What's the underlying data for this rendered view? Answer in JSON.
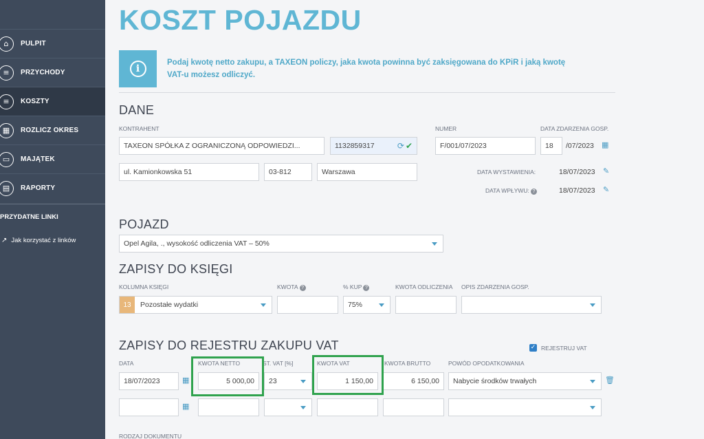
{
  "sidebar": {
    "items": [
      {
        "label": "PULPIT",
        "icon": "home-icon",
        "glyph": "⌂"
      },
      {
        "label": "PRZYCHODY",
        "icon": "coins-plus-icon",
        "glyph": "≡"
      },
      {
        "label": "KOSZTY",
        "icon": "coins-icon",
        "glyph": "≡"
      },
      {
        "label": "ROZLICZ OKRES",
        "icon": "calculator-icon",
        "glyph": "▦"
      },
      {
        "label": "MAJĄTEK",
        "icon": "laptop-icon",
        "glyph": "▭"
      },
      {
        "label": "RAPORTY",
        "icon": "reports-icon",
        "glyph": "▤"
      }
    ],
    "useful_links_heading": "PRZYDATNE LINKI",
    "link_label": "Jak korzystać z linków"
  },
  "page": {
    "title": "KOSZT POJAZDU",
    "info": "Podaj kwotę netto zakupu, a TAXEON policzy, jaka kwota powinna być zaksięgowana do KPiR i jaką kwotę VAT-u możesz odliczyć."
  },
  "dane": {
    "heading": "DANE",
    "kontrahent_label": "KONTRAHENT",
    "kontrahent_value": "TAXEON SPÓŁKA Z OGRANICZONĄ ODPOWIEDZI...",
    "nip_value": "1132859317",
    "street_value": "ul. Kamionkowska 51",
    "postal_value": "03-812",
    "city_value": "Warszawa",
    "numer_label": "NUMER",
    "numer_value": "F/001/07/2023",
    "data_zdarzenia_label": "DATA ZDARZENIA GOSP.",
    "data_zdarzenia_day": "18",
    "data_zdarzenia_month": "/07/2023",
    "data_wystawienia_label": "DATA WYSTAWIENIA:",
    "data_wystawienia_value": "18/07/2023",
    "data_wplywu_label": "DATA WPŁYWU:",
    "data_wplywu_value": "18/07/2023"
  },
  "pojazd": {
    "heading": "POJAZD",
    "selected": "Opel Agila, ., wysokość odliczenia VAT – 50%"
  },
  "ksiega": {
    "heading": "ZAPISY DO KSIĘGI",
    "kolumna_label": "KOLUMNA KSIĘGI",
    "kolumna_number": "13",
    "kolumna_value": "Pozostałe wydatki",
    "kwota_label": "KWOTA",
    "kup_label": "% KUP",
    "kup_value": "75%",
    "kwota_odliczenia_label": "KWOTA ODLICZENIA",
    "opis_label": "OPIS ZDARZENIA GOSP."
  },
  "vat": {
    "heading": "ZAPISY DO REJESTRU ZAKUPU VAT",
    "rejestruj_label": "REJESTRUJ VAT",
    "data_label": "DATA",
    "netto_label": "KWOTA NETTO",
    "stawka_label": "ST. VAT [%]",
    "kwota_vat_label": "KWOTA VAT",
    "brutto_label": "KWOTA BRUTTO",
    "powod_label": "POWÓD OPODATKOWANIA",
    "row1": {
      "data": "18/07/2023",
      "netto": "5 000,00",
      "stawka": "23",
      "kwota_vat": "1 150,00",
      "brutto": "6 150,00",
      "powod": "Nabycie środków trwałych"
    },
    "rodzaj_label": "RODZAJ DOKUMENTU"
  },
  "colors": {
    "accent": "#5fb6d4",
    "sidebar": "#3e4a5b",
    "highlight_box": "#2fa24d"
  }
}
